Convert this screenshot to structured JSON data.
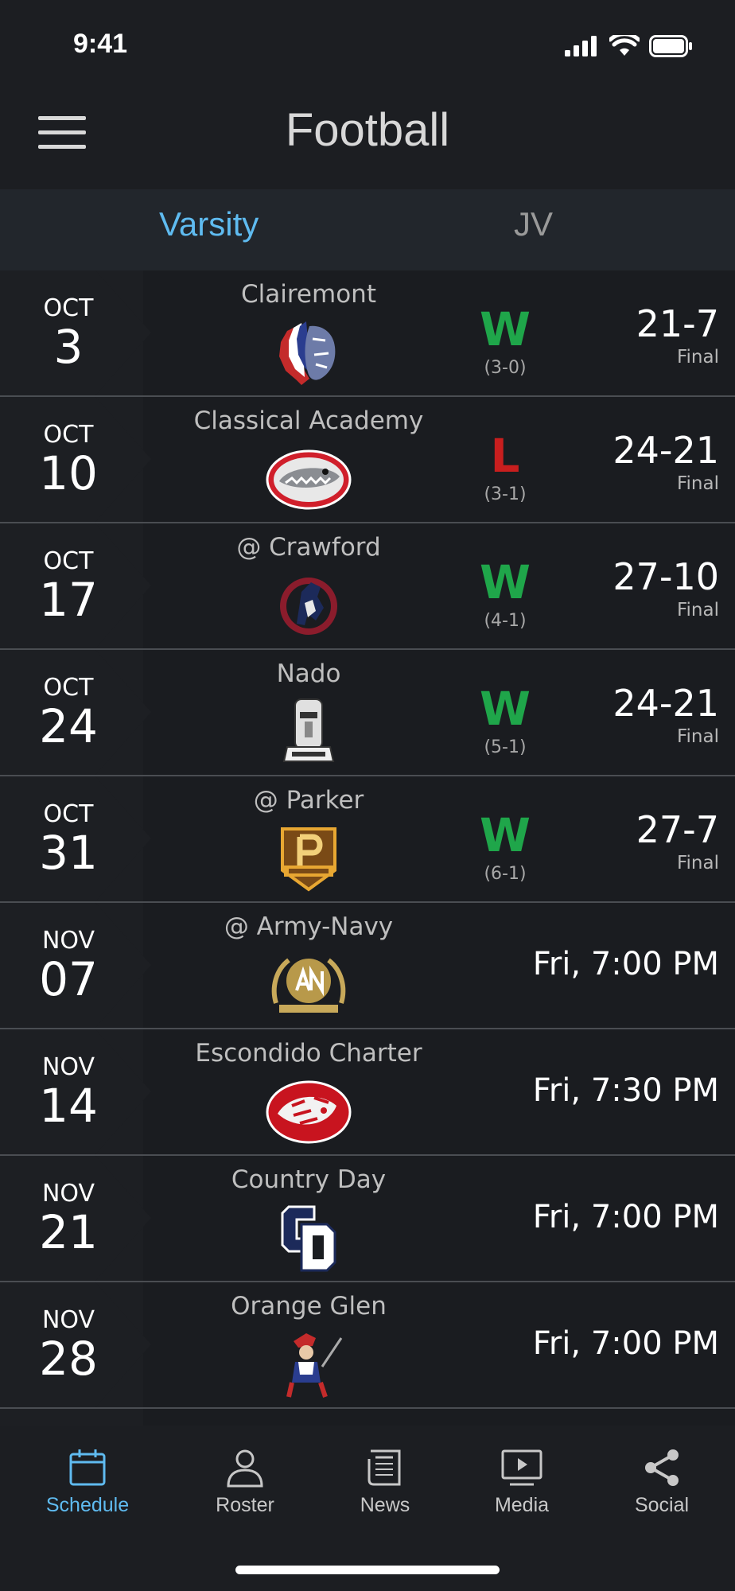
{
  "status": {
    "time": "9:41"
  },
  "header": {
    "title": "Football"
  },
  "tabs": [
    {
      "label": "Varsity",
      "active": true
    },
    {
      "label": "JV",
      "active": false
    }
  ],
  "games": [
    {
      "month": "OCT",
      "day": "3",
      "opponent": "Clairemont",
      "logo": "clairemont-logo",
      "result": "W",
      "record": "(3-0)",
      "score": "21-7",
      "status": "Final"
    },
    {
      "month": "OCT",
      "day": "10",
      "opponent": "Classical Academy",
      "logo": "classical-academy-logo",
      "result": "L",
      "record": "(3-1)",
      "score": "24-21",
      "status": "Final"
    },
    {
      "month": "OCT",
      "day": "17",
      "opponent": "@ Crawford",
      "logo": "crawford-logo",
      "result": "W",
      "record": "(4-1)",
      "score": "27-10",
      "status": "Final"
    },
    {
      "month": "OCT",
      "day": "24",
      "opponent": "Nado",
      "logo": "nado-logo",
      "result": "W",
      "record": "(5-1)",
      "score": "24-21",
      "status": "Final"
    },
    {
      "month": "OCT",
      "day": "31",
      "opponent": "@ Parker",
      "logo": "parker-logo",
      "result": "W",
      "record": "(6-1)",
      "score": "27-7",
      "status": "Final"
    },
    {
      "month": "NOV",
      "day": "07",
      "opponent": "@ Army-Navy",
      "logo": "army-navy-logo",
      "time": "Fri, 7:00 PM"
    },
    {
      "month": "NOV",
      "day": "14",
      "opponent": "Escondido Charter",
      "logo": "escondido-charter-logo",
      "time": "Fri, 7:30 PM"
    },
    {
      "month": "NOV",
      "day": "21",
      "opponent": "Country Day",
      "logo": "country-day-logo",
      "time": "Fri, 7:00 PM"
    },
    {
      "month": "NOV",
      "day": "28",
      "opponent": "Orange Glen",
      "logo": "orange-glen-logo",
      "time": "Fri, 7:00 PM"
    }
  ],
  "nav": [
    {
      "label": "Schedule",
      "icon": "calendar-icon",
      "active": true
    },
    {
      "label": "Roster",
      "icon": "person-icon"
    },
    {
      "label": "News",
      "icon": "newspaper-icon"
    },
    {
      "label": "Media",
      "icon": "play-screen-icon"
    },
    {
      "label": "Social",
      "icon": "share-icon"
    }
  ],
  "colors": {
    "accent": "#5fbbf0",
    "win": "#1fa64a",
    "loss": "#c81e1e",
    "background": "#1a1c20"
  }
}
